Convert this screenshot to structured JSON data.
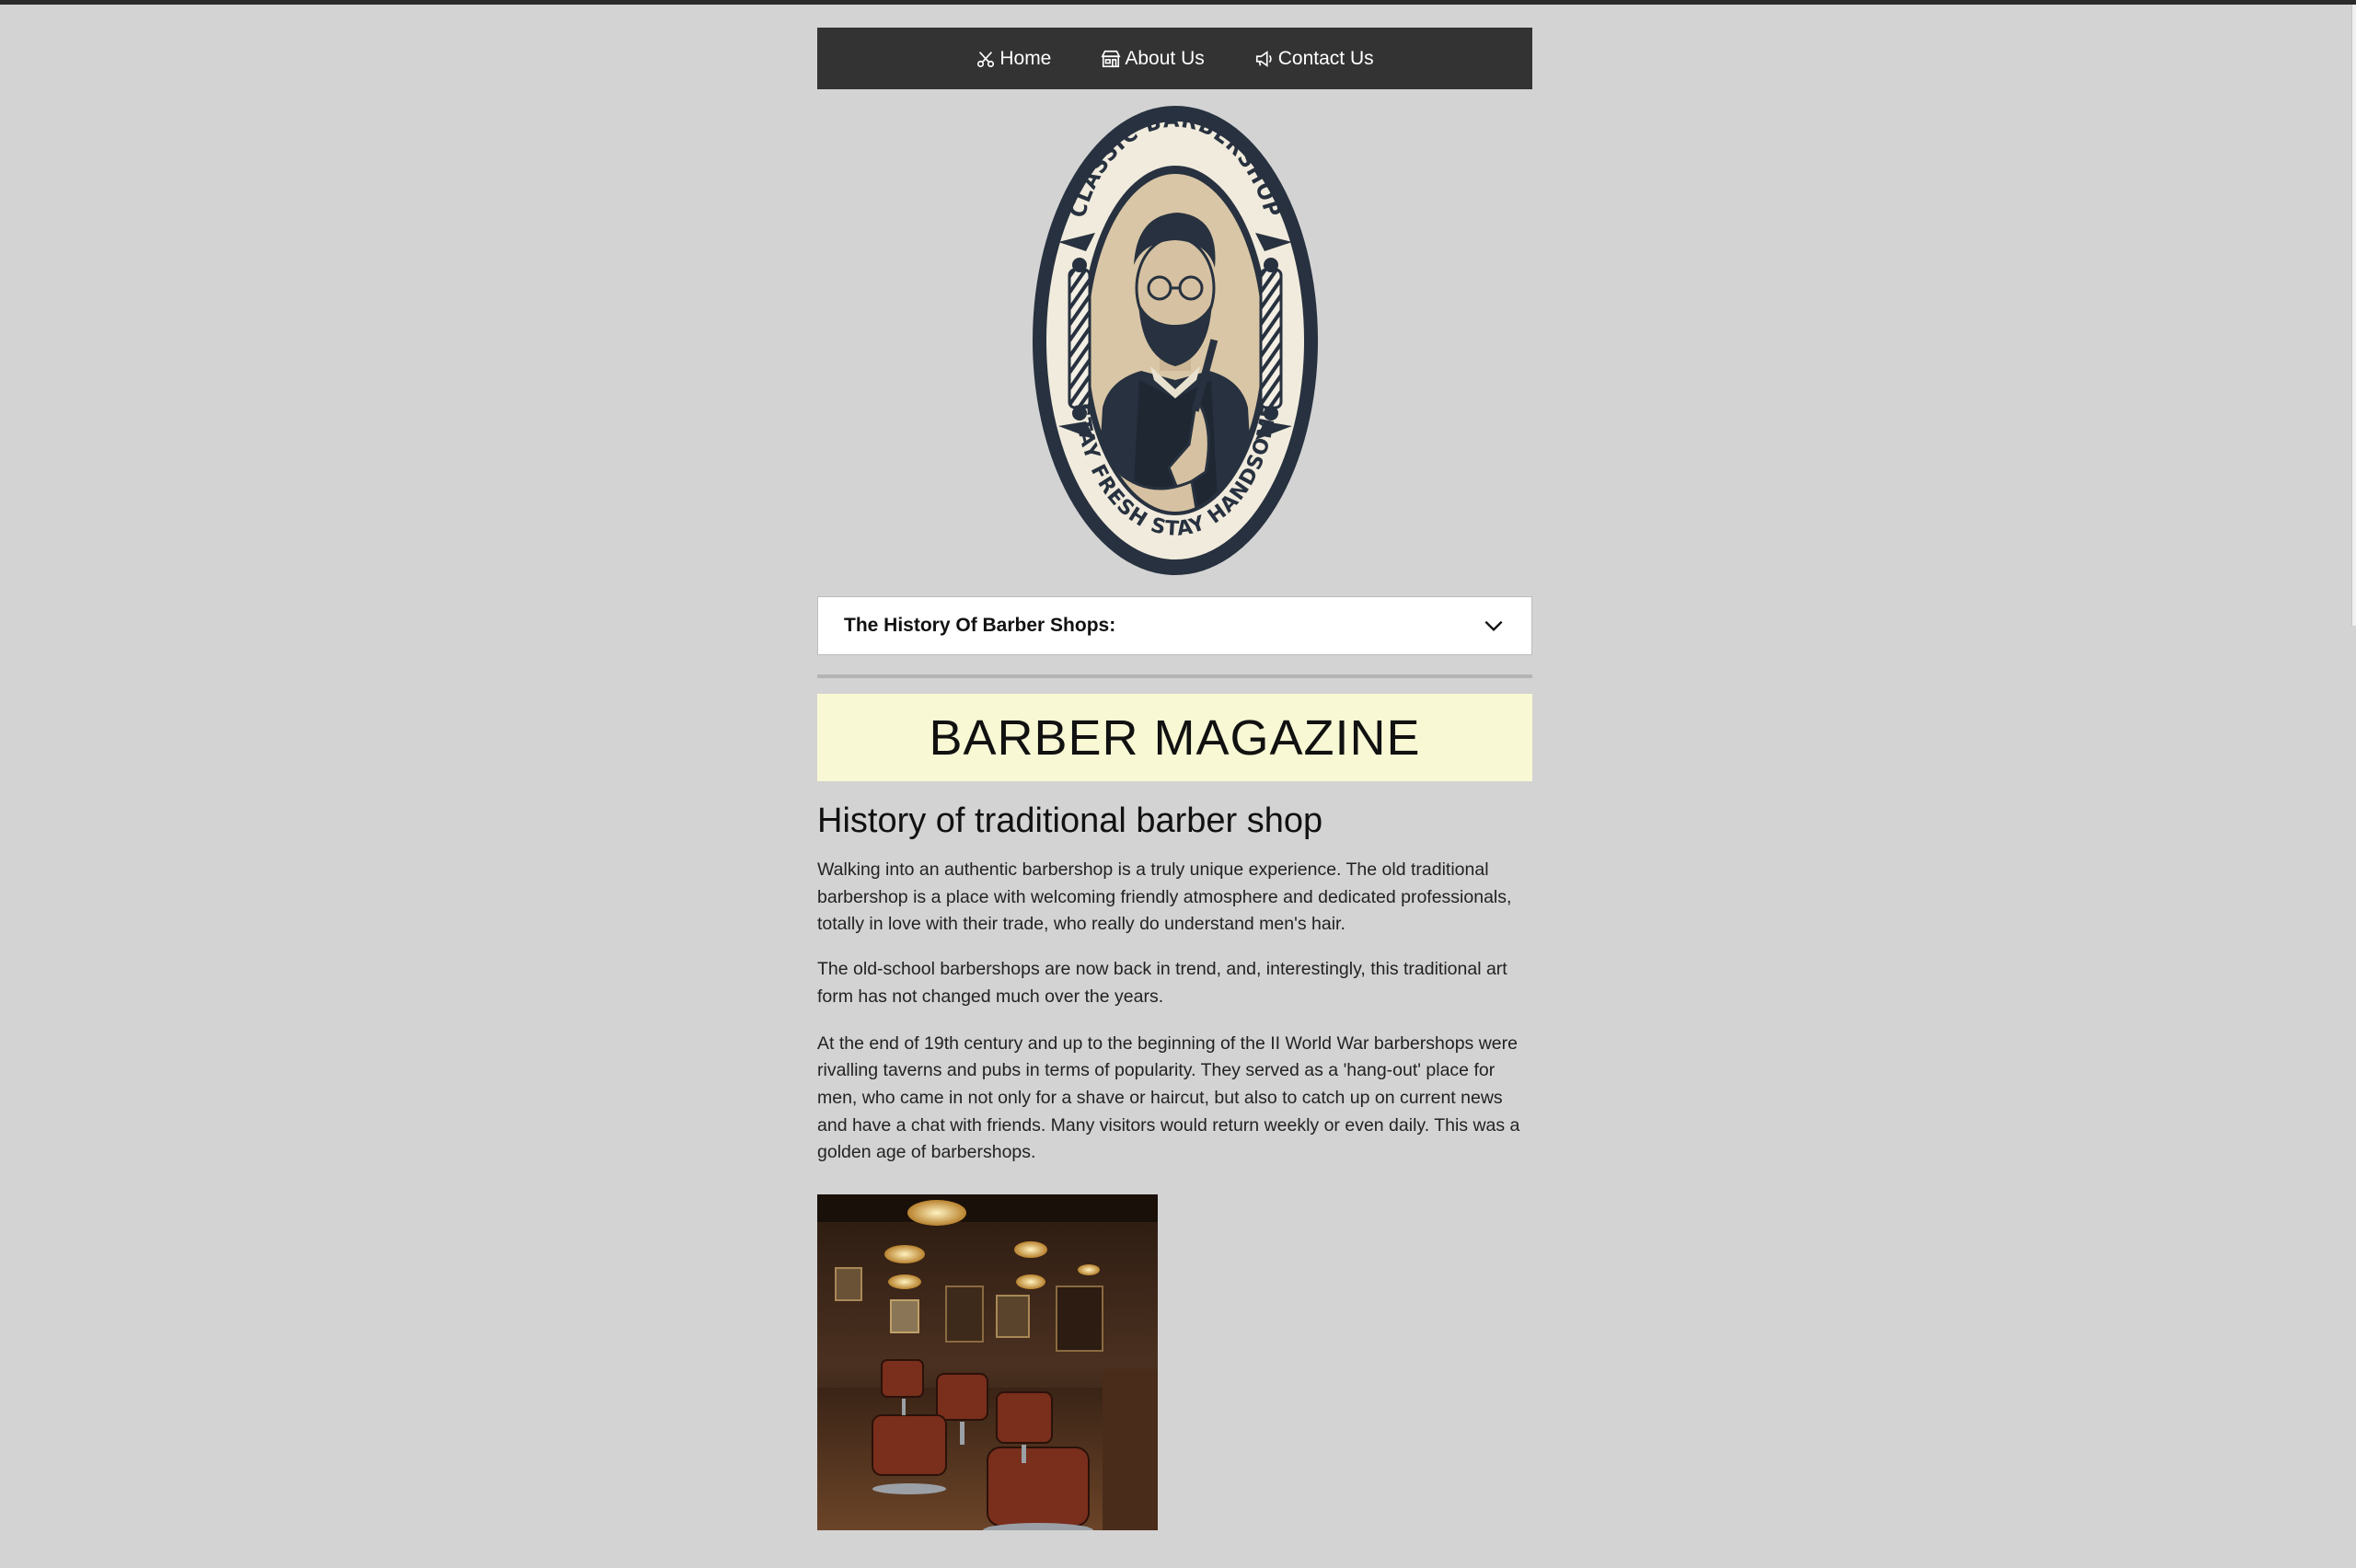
{
  "nav": {
    "items": [
      {
        "label": "Home",
        "icon": "scissors-icon"
      },
      {
        "label": "About Us",
        "icon": "shop-icon"
      },
      {
        "label": "Contact Us",
        "icon": "megaphone-icon"
      }
    ]
  },
  "logo": {
    "top_text": "CLASSIC BARBERSHOP",
    "bottom_text": "STAY FRESH STAY HANDSOME"
  },
  "accordion": {
    "title": "The History Of Barber Shops:",
    "icon": "chevron-down-icon"
  },
  "banner": {
    "title": "BARBER MAGAZINE",
    "background": "#f8f8d5"
  },
  "article": {
    "heading": "History of traditional barber shop",
    "paragraphs": [
      "Walking into an authentic barbershop is a truly unique experience. The old traditional barbershop is a place with welcoming friendly atmosphere and dedicated professionals, totally in love with their trade, who really do understand men's hair.",
      "The old-school barbershops are now back in trend, and, interestingly, this traditional art form has not changed much over the years.",
      "At the end of 19th century and up to the beginning of the II World War barbershops were rivalling taverns and pubs in terms of popularity. They served as a 'hang-out' place for men, who came in not only for a shave or haircut, but also to catch up on current news and have a chat with friends. Many visitors would return weekly or even daily. This was a golden age of barbershops."
    ]
  },
  "colors": {
    "nav_bg": "#333333",
    "page_bg": "#d3d3d3",
    "logo_navy": "#27313f",
    "logo_beige": "#d9c6a6"
  }
}
